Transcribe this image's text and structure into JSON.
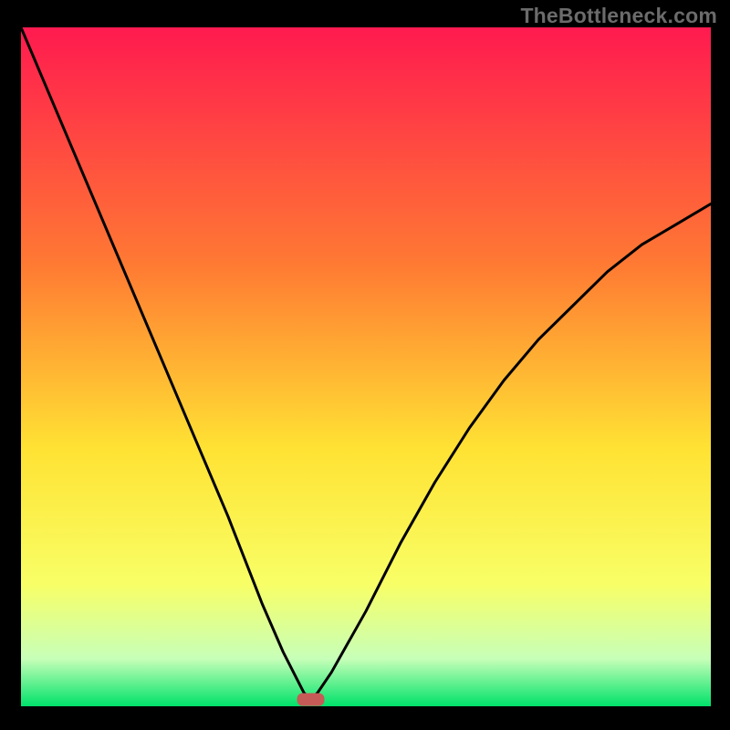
{
  "watermark": "TheBottleneck.com",
  "colors": {
    "frame": "#000000",
    "gradient_top": "#ff1a4f",
    "gradient_mid1": "#ff7a33",
    "gradient_mid2": "#ffe233",
    "gradient_mid3": "#f8ff66",
    "gradient_low": "#c7ffb8",
    "gradient_bottom": "#00e26a",
    "curve": "#000000",
    "marker": "#c65a57"
  },
  "chart_data": {
    "type": "line",
    "title": "",
    "xlabel": "",
    "ylabel": "",
    "xlim": [
      0,
      100
    ],
    "ylim": [
      0,
      100
    ],
    "annotations": [
      {
        "name": "minimum-marker",
        "x": 42,
        "y": 1
      }
    ],
    "series": [
      {
        "name": "bottleneck-curve",
        "x": [
          0,
          5,
          10,
          15,
          20,
          25,
          30,
          35,
          38,
          40,
          41,
          42,
          43,
          45,
          50,
          55,
          60,
          65,
          70,
          75,
          80,
          85,
          90,
          95,
          100
        ],
        "y": [
          100,
          88,
          76,
          64,
          52,
          40,
          28,
          15,
          8,
          4,
          2,
          1,
          2,
          5,
          14,
          24,
          33,
          41,
          48,
          54,
          59,
          64,
          68,
          71,
          74
        ]
      }
    ]
  }
}
